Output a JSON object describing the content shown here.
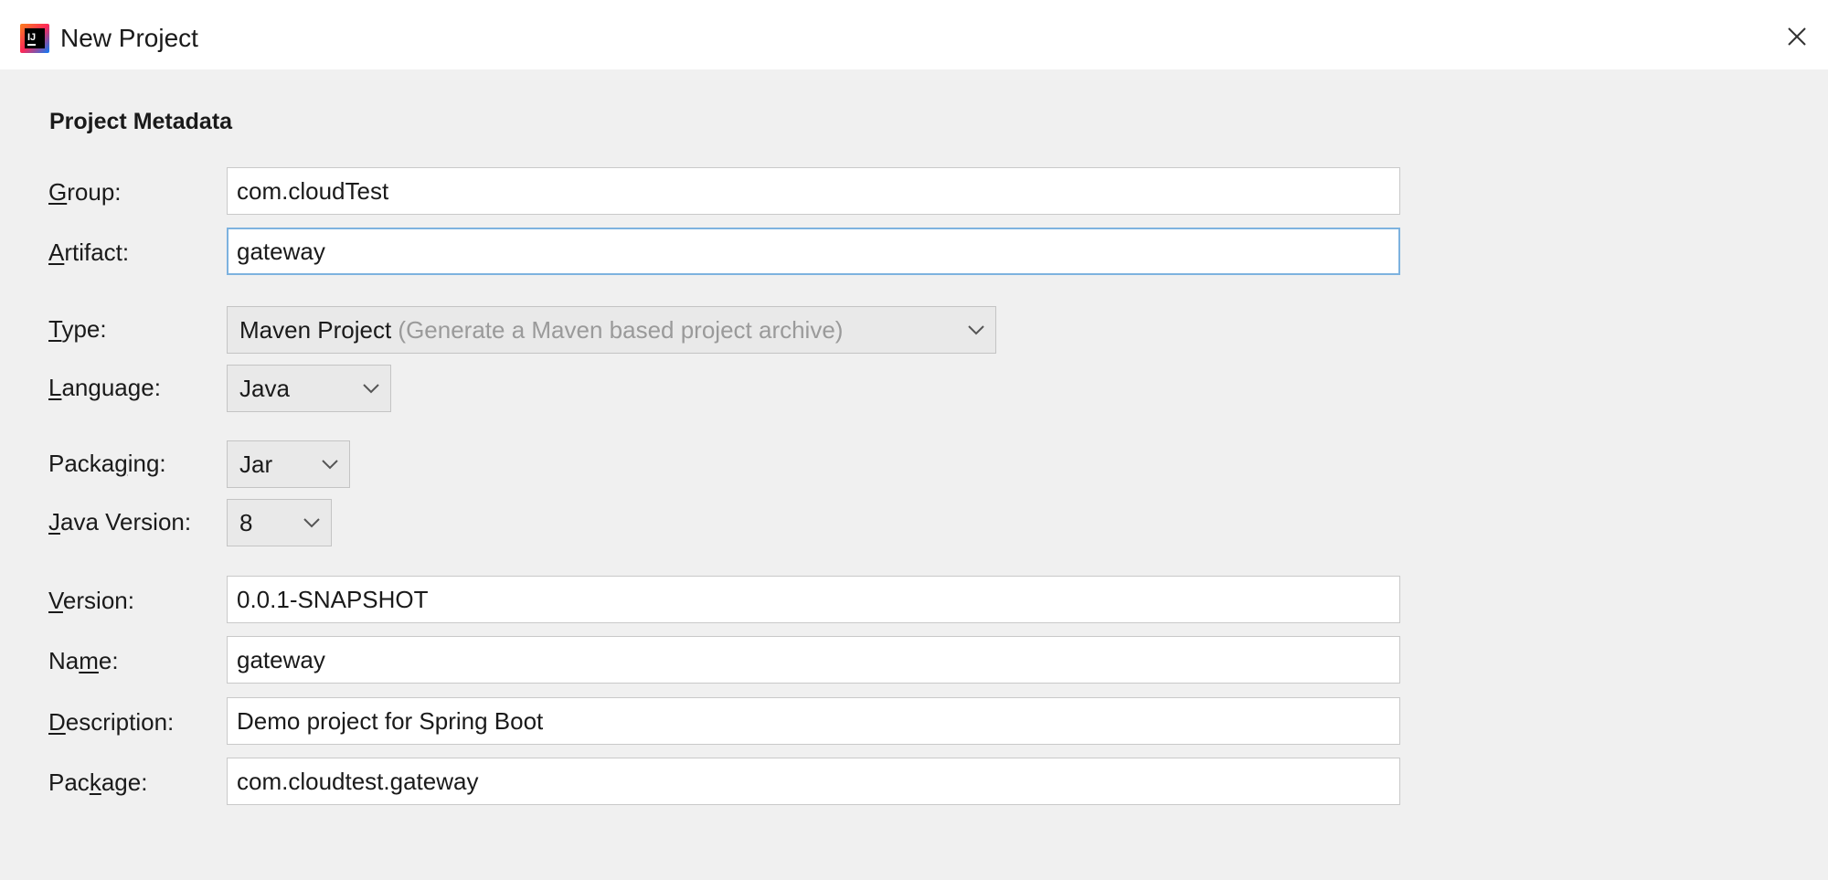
{
  "window": {
    "title": "New Project",
    "app_icon": "intellij-idea-icon",
    "close_icon": "close-icon"
  },
  "section": {
    "title": "Project Metadata"
  },
  "form": {
    "group": {
      "label_underline": "G",
      "label_rest": "roup:",
      "value": "com.cloudTest"
    },
    "artifact": {
      "label_underline": "A",
      "label_rest": "rtifact:",
      "value": "gateway"
    },
    "type": {
      "label_underline": "T",
      "label_rest": "ype:",
      "value": "Maven Project",
      "hint": "(Generate a Maven based project archive)"
    },
    "language": {
      "label_underline": "L",
      "label_rest": "anguage:",
      "value": "Java"
    },
    "packaging": {
      "label_before": "Packa",
      "label_underline": "g",
      "label_after": "ing:",
      "value": "Jar"
    },
    "java_version": {
      "label_underline": "J",
      "label_rest": "ava Version:",
      "value": "8"
    },
    "version": {
      "label_underline": "V",
      "label_rest": "ersion:",
      "value": "0.0.1-SNAPSHOT"
    },
    "name": {
      "label_before": "Na",
      "label_underline": "m",
      "label_after": "e:",
      "value": "gateway"
    },
    "description": {
      "label_underline": "D",
      "label_rest": "escription:",
      "value": "Demo project for Spring Boot"
    },
    "package": {
      "label_before": "Pac",
      "label_underline": "k",
      "label_after": "age:",
      "value": "com.cloudtest.gateway"
    }
  },
  "colors": {
    "background": "#f0f0f0",
    "focus_border": "#7db2df",
    "hint_text": "#9a9a9a"
  }
}
